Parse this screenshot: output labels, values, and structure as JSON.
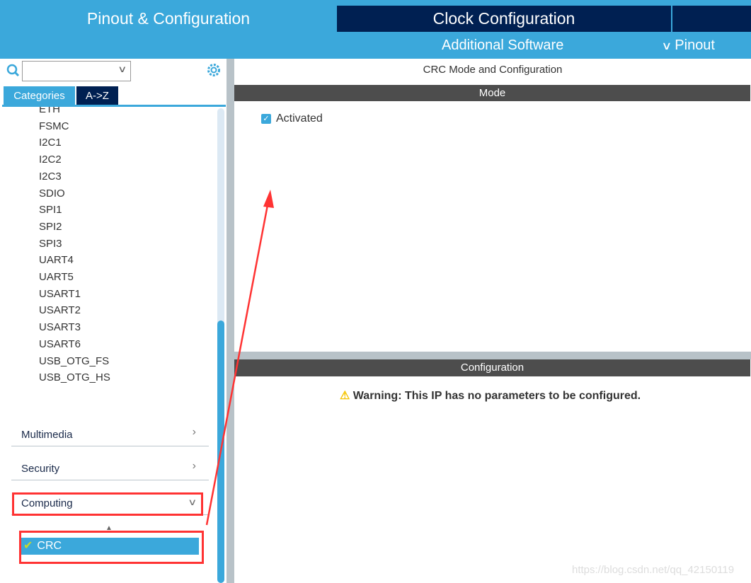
{
  "tabs": {
    "pinout": "Pinout & Configuration",
    "clock": "Clock Configuration",
    "additional_software": "Additional Software",
    "pinout_menu": "Pinout"
  },
  "sidebar": {
    "search": {
      "value": "",
      "placeholder": ""
    },
    "category_tabs": [
      "Categories",
      "A->Z"
    ],
    "items": [
      "ETH",
      "FSMC",
      "I2C1",
      "I2C2",
      "I2C3",
      "SDIO",
      "SPI1",
      "SPI2",
      "SPI3",
      "UART4",
      "UART5",
      "USART1",
      "USART2",
      "USART3",
      "USART6",
      "USB_OTG_FS",
      "USB_OTG_HS"
    ],
    "categories": [
      {
        "label": "Multimedia",
        "expanded": false
      },
      {
        "label": "Security",
        "expanded": false
      },
      {
        "label": "Computing",
        "expanded": true
      }
    ],
    "computing_items": [
      {
        "label": "CRC",
        "selected": true,
        "enabled": true
      }
    ]
  },
  "main": {
    "title": "CRC Mode and Configuration",
    "mode_header": "Mode",
    "activated_label": "Activated",
    "activated": true,
    "config_header": "Configuration",
    "warning": "Warning: This IP has no parameters to be configured."
  },
  "watermark": "https://blog.csdn.net/qq_42150119",
  "colors": {
    "accent": "#3ba8db",
    "dark_navy": "#002052",
    "annotation": "#ff3333"
  }
}
